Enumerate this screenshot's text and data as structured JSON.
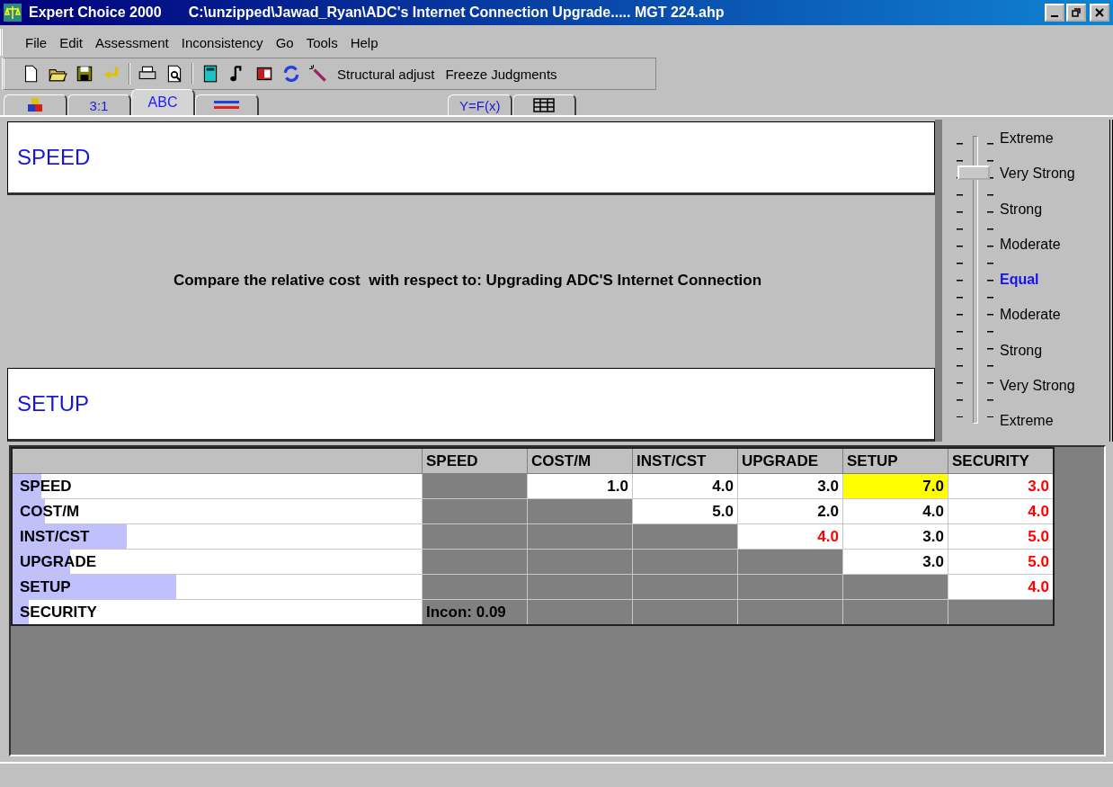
{
  "window": {
    "title": "Expert Choice 2000",
    "file_path": "C:\\unzipped\\Jawad_Ryan\\ADC's Internet Connection Upgrade..... MGT 224.ahp"
  },
  "menu": [
    "File",
    "Edit",
    "Assessment",
    "Inconsistency",
    "Go",
    "Tools",
    "Help"
  ],
  "toolbar_buttons": [
    "Structural adjust",
    "Freeze Judgments"
  ],
  "tabs": [
    {
      "kind": "blocks",
      "selected": false
    },
    {
      "kind": "text",
      "label": "3:1",
      "selected": false
    },
    {
      "kind": "text",
      "label": "ABC",
      "selected": true
    },
    {
      "kind": "bars",
      "selected": false
    },
    {
      "kind": "gap"
    },
    {
      "kind": "text",
      "label": "Y=F(x)",
      "selected": false
    },
    {
      "kind": "grid",
      "selected": false
    }
  ],
  "comparison": {
    "top_item": "SPEED",
    "prompt": "Compare the relative cost  with respect to: Upgrading ADC'S Internet Connection",
    "bottom_item": "SETUP"
  },
  "scale": {
    "level": 0.875,
    "labels": [
      {
        "label": "Extreme",
        "highlighted": false
      },
      {
        "label": "Very Strong",
        "highlighted": false
      },
      {
        "label": "Strong",
        "highlighted": false
      },
      {
        "label": "Moderate",
        "highlighted": false
      },
      {
        "label": "Equal",
        "highlighted": true
      },
      {
        "label": "Moderate",
        "highlighted": false
      },
      {
        "label": "Strong",
        "highlighted": false
      },
      {
        "label": "Very Strong",
        "highlighted": false
      },
      {
        "label": "Extreme",
        "highlighted": false
      }
    ]
  },
  "matrix": {
    "columns": [
      "SPEED",
      "COST/M",
      "INST/CST",
      "UPGRADE",
      "SETUP",
      "SECURITY"
    ],
    "rows": [
      {
        "name": "SPEED",
        "level": 0.07,
        "cells": [
          {
            "kind": "empty"
          },
          {
            "kind": "entry",
            "value": "1.0",
            "inverse": false,
            "selected": false
          },
          {
            "kind": "entry",
            "value": "4.0",
            "inverse": false,
            "selected": false
          },
          {
            "kind": "entry",
            "value": "3.0",
            "inverse": false,
            "selected": false
          },
          {
            "kind": "entry",
            "value": "7.0",
            "inverse": false,
            "selected": true
          },
          {
            "kind": "entry",
            "value": "3.0",
            "inverse": true,
            "selected": false
          }
        ]
      },
      {
        "name": "COST/M",
        "level": 0.08,
        "cells": [
          {
            "kind": "empty"
          },
          {
            "kind": "empty"
          },
          {
            "kind": "entry",
            "value": "5.0",
            "inverse": false,
            "selected": false
          },
          {
            "kind": "entry",
            "value": "2.0",
            "inverse": false,
            "selected": false
          },
          {
            "kind": "entry",
            "value": "4.0",
            "inverse": false,
            "selected": false
          },
          {
            "kind": "entry",
            "value": "4.0",
            "inverse": true,
            "selected": false
          }
        ]
      },
      {
        "name": "INST/CST",
        "level": 0.28,
        "cells": [
          {
            "kind": "empty"
          },
          {
            "kind": "empty"
          },
          {
            "kind": "empty"
          },
          {
            "kind": "entry",
            "value": "4.0",
            "inverse": true,
            "selected": false
          },
          {
            "kind": "entry",
            "value": "3.0",
            "inverse": false,
            "selected": false
          },
          {
            "kind": "entry",
            "value": "5.0",
            "inverse": true,
            "selected": false
          }
        ]
      },
      {
        "name": "UPGRADE",
        "level": 0.14,
        "cells": [
          {
            "kind": "empty"
          },
          {
            "kind": "empty"
          },
          {
            "kind": "empty"
          },
          {
            "kind": "empty"
          },
          {
            "kind": "entry",
            "value": "3.0",
            "inverse": false,
            "selected": false
          },
          {
            "kind": "entry",
            "value": "5.0",
            "inverse": true,
            "selected": false
          }
        ]
      },
      {
        "name": "SETUP",
        "level": 0.4,
        "cells": [
          {
            "kind": "empty"
          },
          {
            "kind": "empty"
          },
          {
            "kind": "empty"
          },
          {
            "kind": "empty"
          },
          {
            "kind": "empty"
          },
          {
            "kind": "entry",
            "value": "4.0",
            "inverse": true,
            "selected": false
          }
        ]
      },
      {
        "name": "SECURITY",
        "level": 0.04,
        "cells": [
          {
            "kind": "note",
            "value": "Incon: 0.09"
          },
          {
            "kind": "empty"
          },
          {
            "kind": "empty"
          },
          {
            "kind": "empty"
          },
          {
            "kind": "empty"
          },
          {
            "kind": "empty"
          }
        ]
      }
    ]
  }
}
